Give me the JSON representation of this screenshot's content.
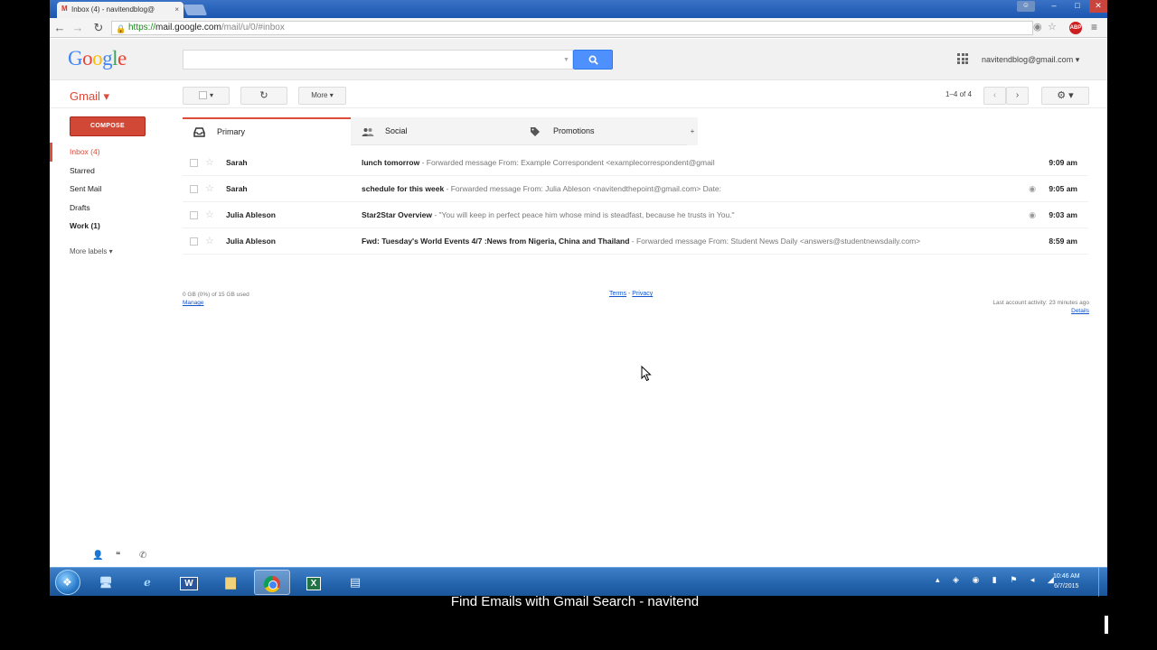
{
  "browser": {
    "tab_title": "Inbox (4) - navitendblog@",
    "tab_close": "×",
    "url_scheme": "https://",
    "url_host": "mail.google.com",
    "url_path": "/mail/u/0/#inbox",
    "window_controls": {
      "minimize": "–",
      "maximize": "□",
      "close": "✕"
    }
  },
  "header": {
    "logo_letters": [
      {
        "ch": "G",
        "color": "#4285f4"
      },
      {
        "ch": "o",
        "color": "#ea4335"
      },
      {
        "ch": "o",
        "color": "#fbbc05"
      },
      {
        "ch": "g",
        "color": "#4285f4"
      },
      {
        "ch": "l",
        "color": "#34a853"
      },
      {
        "ch": "e",
        "color": "#ea4335"
      }
    ],
    "search_value": "",
    "account": "navitendblog@gmail.com ▾"
  },
  "actions": {
    "gmail_label": "Gmail ▾",
    "select_caret": "▾",
    "refresh": "↻",
    "more": "More ▾",
    "pager": "1–4 of 4",
    "prev": "‹",
    "next": "›",
    "settings": "⚙ ▾"
  },
  "sidebar": {
    "compose": "COMPOSE",
    "items": [
      {
        "label": "Inbox (4)",
        "active": true,
        "bold": false
      },
      {
        "label": "Starred",
        "active": false,
        "bold": false
      },
      {
        "label": "Sent Mail",
        "active": false,
        "bold": false
      },
      {
        "label": "Drafts",
        "active": false,
        "bold": false
      },
      {
        "label": "Work (1)",
        "active": false,
        "bold": true
      }
    ],
    "more_labels": "More labels ▾"
  },
  "tabs": {
    "primary": "Primary",
    "social": "Social",
    "promotions": "Promotions",
    "add": "+"
  },
  "emails": [
    {
      "sender": "Sarah",
      "subject": "lunch tomorrow",
      "snippet": " - Forwarded message From: Example Correspondent <examplecorrespondent@gmail",
      "time": "9:09 am",
      "watch": false
    },
    {
      "sender": "Sarah",
      "subject": "schedule for this week",
      "snippet": " - Forwarded message From: Julia Ableson <navitendthepoint@gmail.com> Date:",
      "time": "9:05 am",
      "watch": true
    },
    {
      "sender": "Julia Ableson",
      "subject": "Star2Star Overview",
      "snippet": " - \"You will keep in perfect peace him whose mind is steadfast, because he trusts in You.\"",
      "time": "9:03 am",
      "watch": true
    },
    {
      "sender": "Julia Ableson",
      "subject": "Fwd: Tuesday's World Events 4/7 :News from Nigeria, China and Thailand",
      "snippet": " - Forwarded message From: Student News Daily <answers@studentnewsdaily.com>",
      "time": "8:59 am",
      "watch": false
    }
  ],
  "footer": {
    "storage": "0 GB (0%) of 15 GB used",
    "manage": "Manage",
    "terms": "Terms",
    "separator": " - ",
    "privacy": "Privacy",
    "activity": "Last account activity: 23 minutes ago",
    "details": "Details"
  },
  "taskbar": {
    "clock_time": "10:46 AM",
    "clock_date": "6/7/2015",
    "word": "W",
    "excel": "X"
  },
  "caption": "Find Emails with Gmail Search - navitend"
}
